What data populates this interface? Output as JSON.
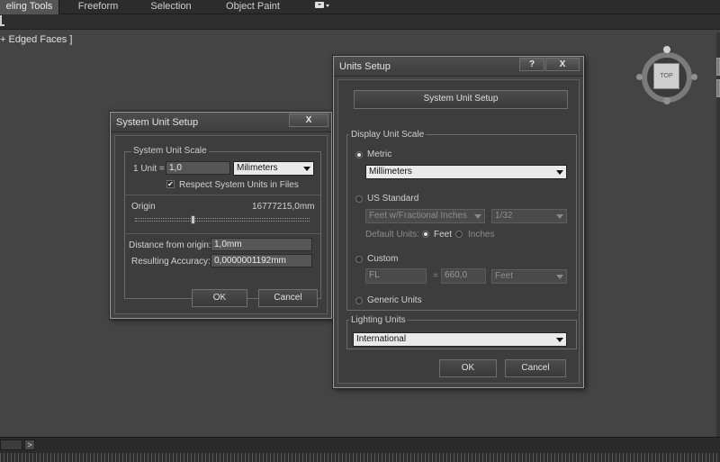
{
  "ribbon": {
    "tabs": [
      "eling Tools",
      "Freeform",
      "Selection",
      "Object Paint"
    ]
  },
  "viewport": {
    "label": "+ Edged Faces ]",
    "viewcube_face": "TOP"
  },
  "timeline": {
    "next_label": ">"
  },
  "system_unit_setup": {
    "title": "System Unit Setup",
    "close_label": "X",
    "group_label": "System Unit Scale",
    "unit_prefix": "1 Unit =",
    "unit_value": "1,0",
    "unit_select": "Milimeters",
    "respect_label": "Respect System Units in Files",
    "respect_checked": true,
    "origin_label": "Origin",
    "origin_value": "16777215,0mm",
    "origin_slider_fraction": 0.33,
    "distance_label": "Distance from origin:",
    "distance_value": "1,0mm",
    "accuracy_label": "Resulting Accuracy:",
    "accuracy_value": "0,0000001192mm",
    "ok_label": "OK",
    "cancel_label": "Cancel"
  },
  "units_setup": {
    "title": "Units Setup",
    "help_label": "?",
    "close_label": "X",
    "system_unit_setup_button": "System Unit Setup",
    "display_group_label": "Display Unit Scale",
    "metric_label": "Metric",
    "metric_selected": true,
    "metric_select": "Millimeters",
    "us_label": "US Standard",
    "us_select": "Feet w/Fractional Inches",
    "us_fraction_select": "1/32",
    "default_units_label": "Default Units:",
    "feet_label": "Feet",
    "inches_label": "Inches",
    "custom_label": "Custom",
    "custom_name": "FL",
    "custom_equals": "=",
    "custom_value": "660,0",
    "custom_unit_select": "Feet",
    "generic_label": "Generic Units",
    "lighting_group_label": "Lighting Units",
    "lighting_select": "International",
    "ok_label": "OK",
    "cancel_label": "Cancel"
  }
}
